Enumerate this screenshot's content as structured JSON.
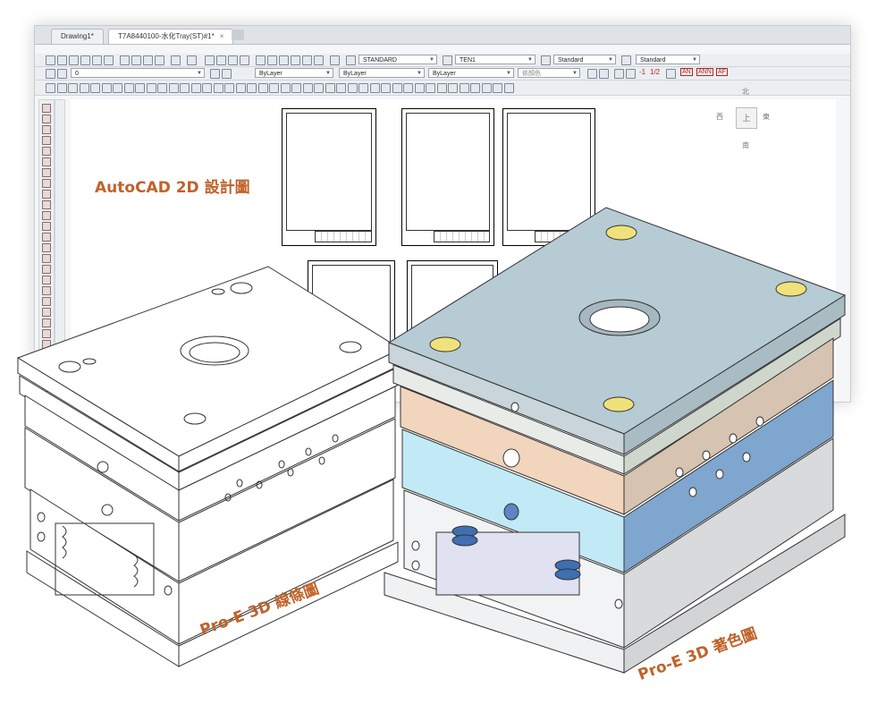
{
  "cad": {
    "tabs": [
      {
        "label": "Drawing1*"
      },
      {
        "label": "T7A8440100-水化Tray(ST)#1*",
        "close": "×"
      }
    ],
    "toolbar_row1": {
      "text_style": "STANDARD",
      "dim_style": "TEN1",
      "table_style": "Standard",
      "multileader_style": "Standard"
    },
    "toolbar_row2": {
      "layer": "0",
      "color": "ByLayer",
      "linetype": "ByLayer",
      "lineweight": "ByLayer",
      "plot_style": "依顏色",
      "scale_a": "-1",
      "scale_b": "1/2",
      "btn_an": "AN",
      "btn_ann": "ANN",
      "btn_af": "AF"
    },
    "viewcube": {
      "north": "北",
      "west": "西",
      "east": "東",
      "south": "南",
      "center": "上"
    }
  },
  "labels": {
    "autocad": "AutoCAD 2D 設計圖",
    "wireframe": "Pro-E 3D 線條圖",
    "shaded": "Pro-E 3D 著色圖"
  },
  "colors": {
    "label": "#c0622a",
    "plate_top": "#b6cbd3",
    "plate_tan": "#d6c3b1",
    "plate_peach": "#f1d5bd",
    "plate_cyan": "#c2eaf6",
    "plate_blue": "#7fa6cf",
    "plate_gray": "#d8dadc",
    "hole_yellow": "#efe27a",
    "spring_blue": "#3f6fb0"
  },
  "icons": [
    "new-icon",
    "open-icon",
    "save-icon",
    "print-icon",
    "undo-icon",
    "redo-icon",
    "pan-icon",
    "zoom-icon",
    "layer-icon",
    "properties-icon",
    "line-icon",
    "circle-icon",
    "arc-icon",
    "move-icon",
    "copy-icon",
    "rotate-icon"
  ]
}
